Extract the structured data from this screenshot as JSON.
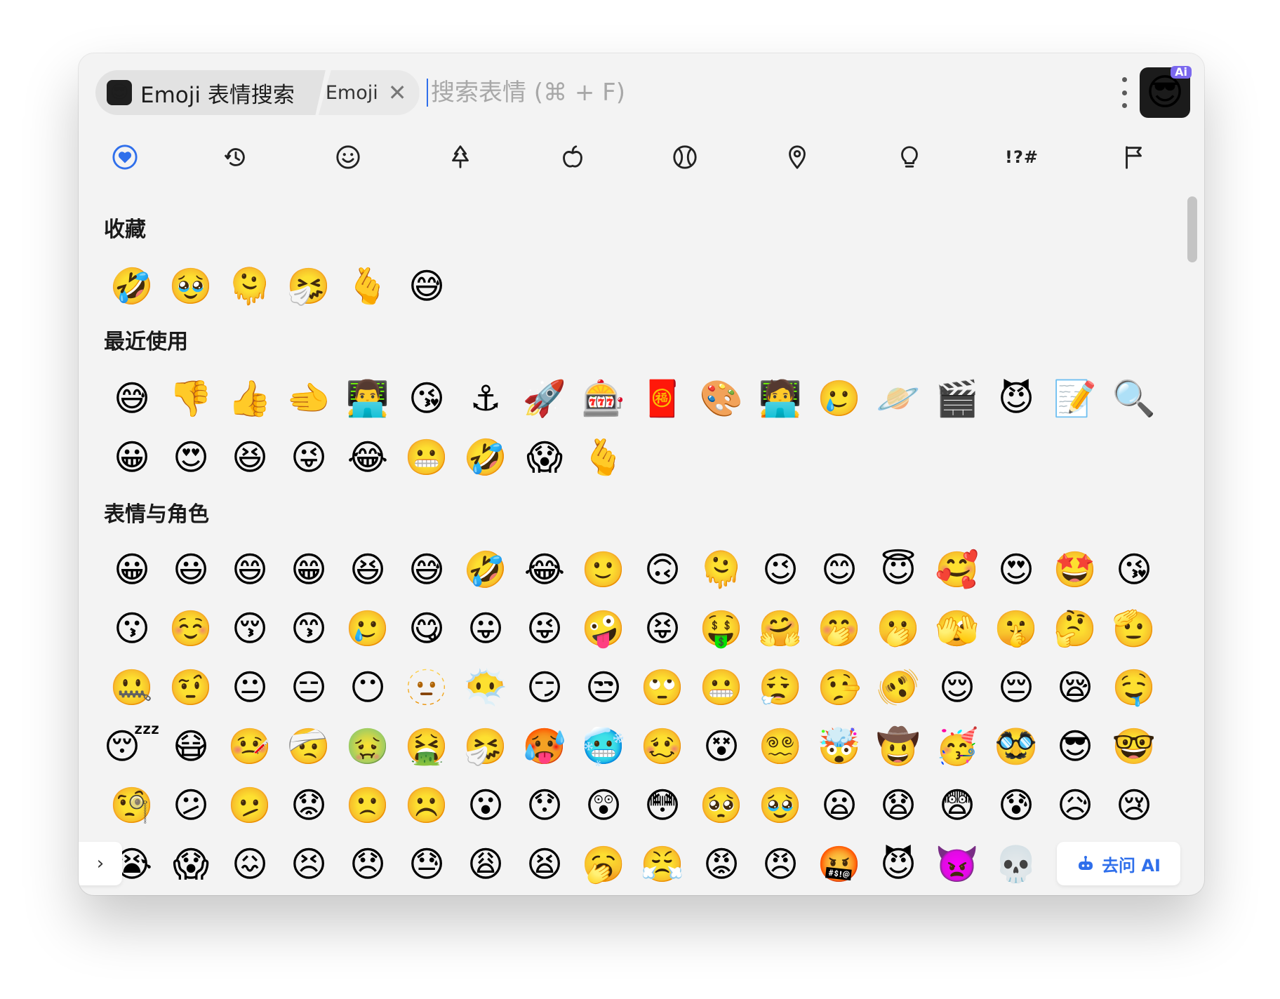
{
  "header": {
    "tab_title": "Emoji 表情搜索",
    "tab_logo": "😎",
    "sub_tab": "Emoji",
    "close_glyph": "✕",
    "search_placeholder": "搜索表情 (⌘ + F)",
    "app_logo": "😎",
    "ai_badge": "Ai"
  },
  "categories": [
    {
      "name": "favorites-heart-icon",
      "active": true
    },
    {
      "name": "recent-clock-icon"
    },
    {
      "name": "smiley-icon"
    },
    {
      "name": "nature-tree-icon"
    },
    {
      "name": "food-apple-icon"
    },
    {
      "name": "activity-ball-icon"
    },
    {
      "name": "travel-pin-icon"
    },
    {
      "name": "objects-bulb-icon"
    },
    {
      "name": "symbols-icon",
      "label": "!?#"
    },
    {
      "name": "flags-icon"
    }
  ],
  "accent_color": "#2f6feb",
  "sections": {
    "favorites": {
      "title": "收藏",
      "emojis": [
        "🤣",
        "🥹",
        "🫠",
        "🤧",
        "🫰",
        "😅"
      ]
    },
    "recent": {
      "title": "最近使用",
      "emojis": [
        "😅",
        "👎",
        "👍",
        "🫲",
        "👨‍💻",
        "😘",
        "⚓",
        "🚀",
        "🎰",
        "🧧",
        "🎨",
        "🧑‍💻",
        "🥲",
        "🪐",
        "🎬",
        "😈",
        "📝",
        "🔍",
        "😀",
        "😍",
        "😆",
        "😜",
        "😂",
        "😬",
        "🤣",
        "😱",
        "🫰"
      ]
    },
    "smileys": {
      "title": "表情与角色",
      "emojis": [
        "😀",
        "😃",
        "😄",
        "😁",
        "😆",
        "😅",
        "🤣",
        "😂",
        "🙂",
        "🙃",
        "🫠",
        "😉",
        "😊",
        "😇",
        "🥰",
        "😍",
        "🤩",
        "😘",
        "😗",
        "☺️",
        "😚",
        "😙",
        "🥲",
        "😋",
        "😛",
        "😜",
        "🤪",
        "😝",
        "🤑",
        "🤗",
        "🤭",
        "🫢",
        "🫣",
        "🤫",
        "🤔",
        "🫡",
        "🤐",
        "🤨",
        "😐",
        "😑",
        "😶",
        "🫥",
        "😶‍🌫️",
        "😏",
        "😒",
        "🙄",
        "😬",
        "😮‍💨",
        "🤥",
        "🫨",
        "😌",
        "😔",
        "😪",
        "🤤",
        "😴",
        "😷",
        "🤒",
        "🤕",
        "🤢",
        "🤮",
        "🤧",
        "🥵",
        "🥶",
        "🥴",
        "😵",
        "😵‍💫",
        "🤯",
        "🤠",
        "🥳",
        "🥸",
        "😎",
        "🤓",
        "🧐",
        "😕",
        "🫤",
        "😟",
        "🙁",
        "☹️",
        "😮",
        "😯",
        "😲",
        "😳",
        "🥺",
        "🥹",
        "😦",
        "😧",
        "😨",
        "😰",
        "😥",
        "😢",
        "😭",
        "😱",
        "😖",
        "😣",
        "😞",
        "😓",
        "😩",
        "😫",
        "🥱",
        "😤",
        "😡",
        "😠",
        "🤬",
        "😈",
        "👿",
        "💀"
      ]
    }
  },
  "footer": {
    "expand_glyph": "›",
    "ask_ai_label": "去问 AI"
  }
}
